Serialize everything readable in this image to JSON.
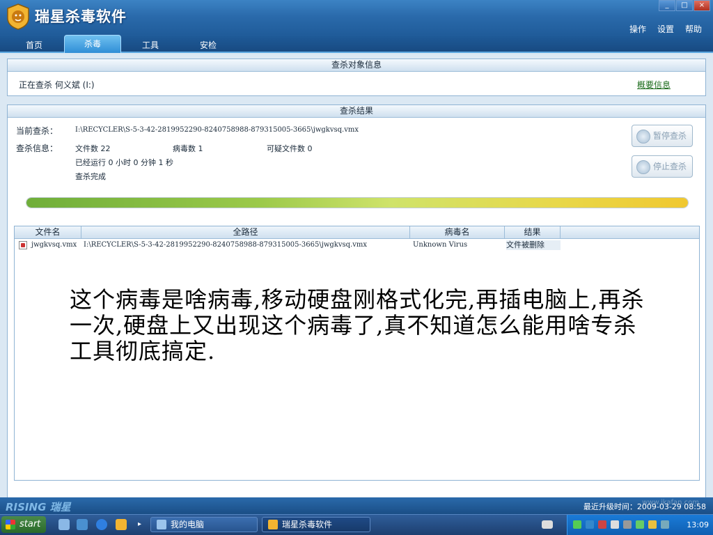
{
  "app": {
    "title": "瑞星杀毒软件",
    "window_controls": [
      "_",
      "□",
      "×"
    ],
    "top_links": [
      "操作",
      "设置",
      "帮助"
    ]
  },
  "tabs": [
    {
      "label": "首页",
      "active": false
    },
    {
      "label": "杀毒",
      "active": true
    },
    {
      "label": "工具",
      "active": false
    },
    {
      "label": "安检",
      "active": false
    }
  ],
  "target_panel": {
    "title": "查杀对象信息",
    "scanning_label": "正在查杀",
    "scanning_target": "何义斌 (I:)",
    "summary_link": "概要信息"
  },
  "result_panel": {
    "title": "查杀结果",
    "current_label": "当前查杀：",
    "current_path": "I:\\RECYCLER\\S-5-3-42-2819952290-8240758988-879315005-3665\\jwgkvsq.vmx",
    "info_label": "查杀信息：",
    "file_count_label": "文件数",
    "file_count": "22",
    "virus_count_label": "病毒数",
    "virus_count": "1",
    "suspicious_label": "可疑文件数",
    "suspicious_count": "0",
    "elapsed": "已经运行 0 小时 0 分钟 1  秒",
    "status": "查杀完成",
    "pause_button": "暂停查杀",
    "stop_button": "停止查杀",
    "progress_percent": 100
  },
  "table": {
    "columns": [
      "文件名",
      "全路径",
      "病毒名",
      "结果"
    ],
    "rows": [
      {
        "file": "jwgkvsq.vmx",
        "path": "I:\\RECYCLER\\S-5-3-42-2819952290-8240758988-879315005-3665\\jwgkvsq.vmx",
        "virus": "Unknown Virus",
        "result": "文件被删除"
      }
    ]
  },
  "overlay_text": "这个病毒是啥病毒,移动硬盘刚格式化完,再插电脑上,再杀一次,硬盘上又出现这个病毒了,真不知道怎么能用啥专杀工具彻底搞定.",
  "footer": {
    "brand": "RISING 瑞星",
    "update": "最近升级时间：2009-03-29 08:58"
  },
  "taskbar": {
    "start": "start",
    "tasks": [
      "我的电脑",
      "瑞星杀毒软件"
    ],
    "clock": "13:09"
  },
  "watermark": "www.ikafan.com"
}
